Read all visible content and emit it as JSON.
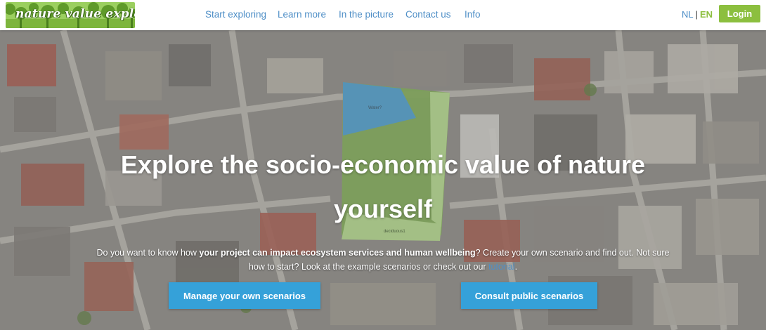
{
  "header": {
    "logo_text": "nature value explorer",
    "nav": [
      {
        "label": "Start exploring"
      },
      {
        "label": "Learn more"
      },
      {
        "label": "In the picture"
      },
      {
        "label": "Contact us"
      },
      {
        "label": "Info"
      }
    ],
    "lang": {
      "nl": "NL",
      "separator": "|",
      "en": "EN",
      "active": "EN"
    },
    "login_label": "Login"
  },
  "hero": {
    "headline": "Explore the socio-economic value of nature yourself",
    "map_labels": {
      "water_zone": "Water?",
      "deciduous_zone": "deciduous1"
    },
    "intro": {
      "part1": "Do you want to know how ",
      "bold": "your project can impact ecosystem services and human wellbeing",
      "part2": "? Create your own scenario and find out. Not sure how to start? Look at the example scenarios or check out our ",
      "link": "tutorial",
      "end": "."
    },
    "buttons": {
      "manage": "Manage your own scenarios",
      "consult": "Consult public scenarios"
    }
  },
  "colors": {
    "nav_link": "#4f8fc7",
    "accent_green": "#8cbf3f",
    "cta_blue": "#35a1d9",
    "zone_blue": "#4a9fd0",
    "zone_green": "#b4dc8c"
  }
}
